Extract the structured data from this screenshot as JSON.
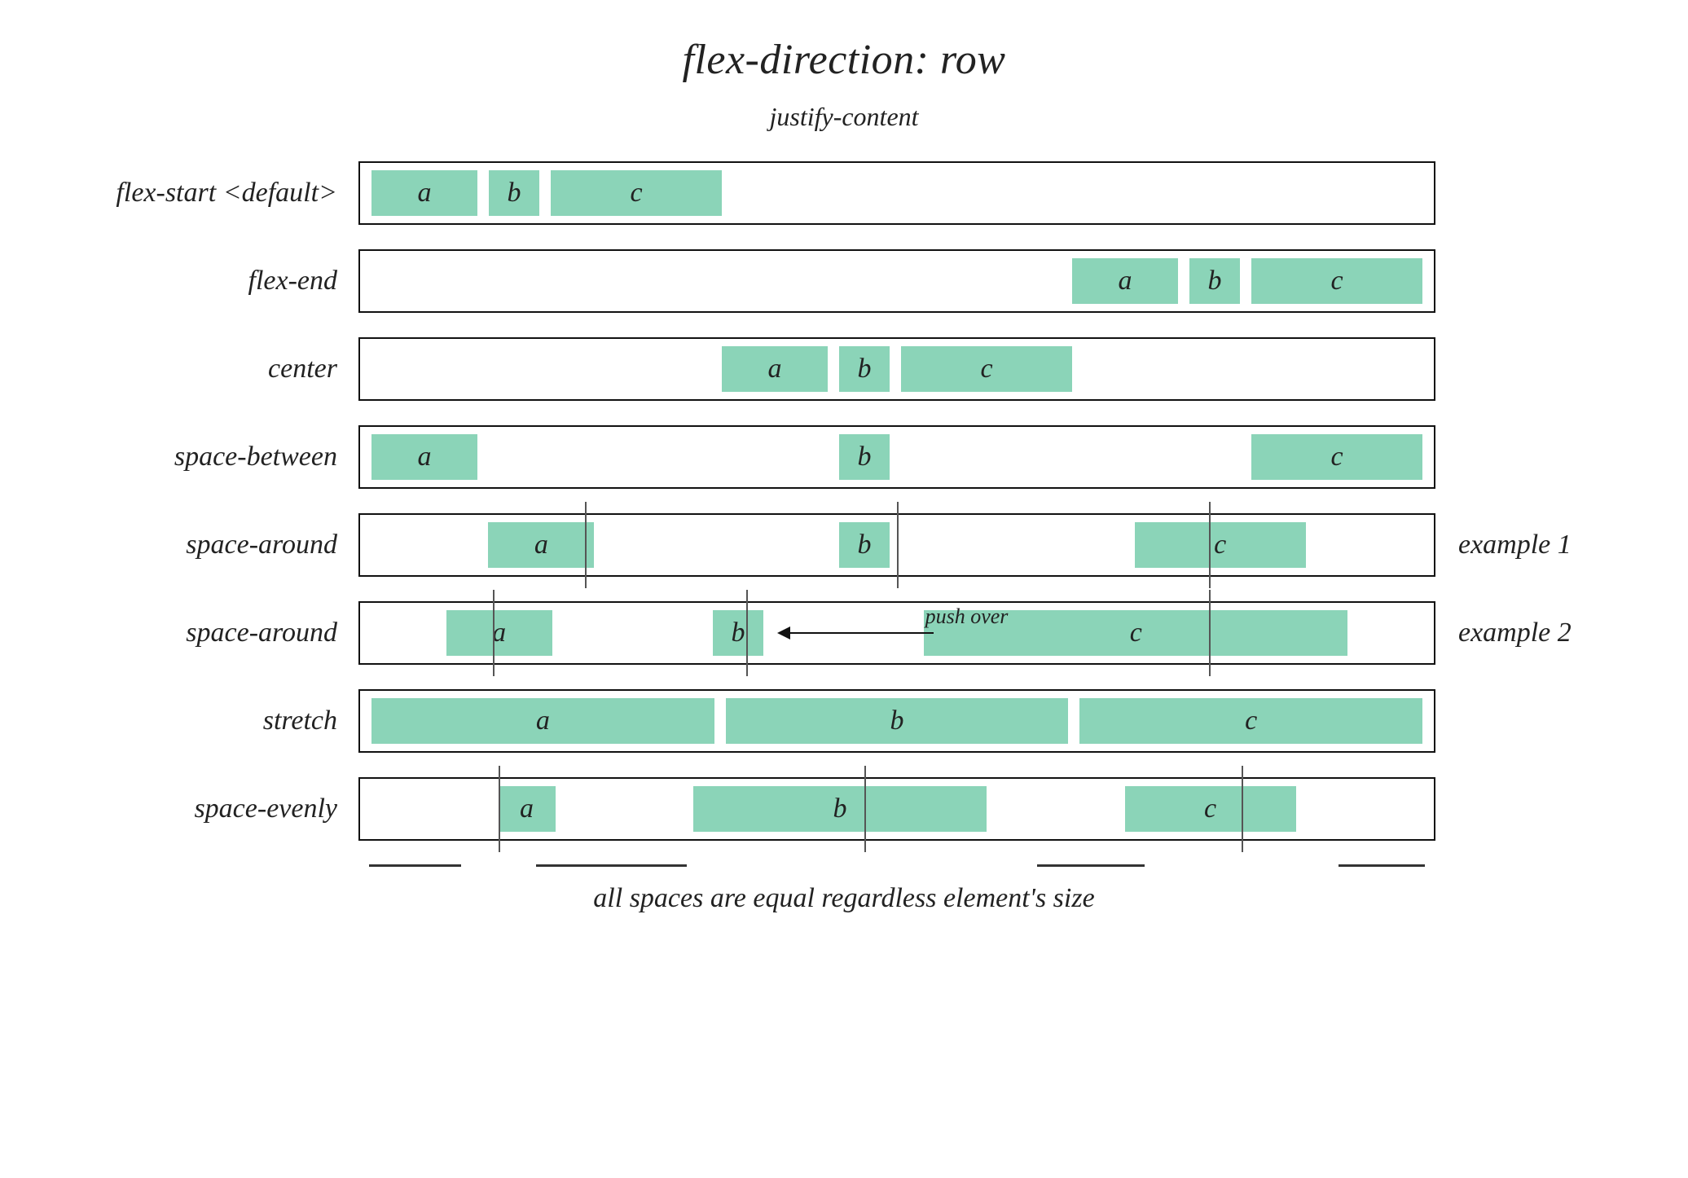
{
  "title": "flex-direction: row",
  "subtitle": "justify-content",
  "caption": "all spaces are equal regardless element's size",
  "items": {
    "a": "a",
    "b": "b",
    "c": "c"
  },
  "rows": {
    "flex_start": {
      "label": "flex-start <default>"
    },
    "flex_end": {
      "label": "flex-end"
    },
    "center": {
      "label": "center"
    },
    "space_between": {
      "label": "space-between"
    },
    "space_around1": {
      "label": "space-around",
      "right": "example 1"
    },
    "space_around2": {
      "label": "space-around",
      "right": "example 2",
      "push_over": "push over"
    },
    "stretch": {
      "label": "stretch"
    },
    "space_evenly": {
      "label": "space-evenly"
    }
  },
  "colors": {
    "item_bg": "#8bd4b8",
    "border": "#111111"
  }
}
